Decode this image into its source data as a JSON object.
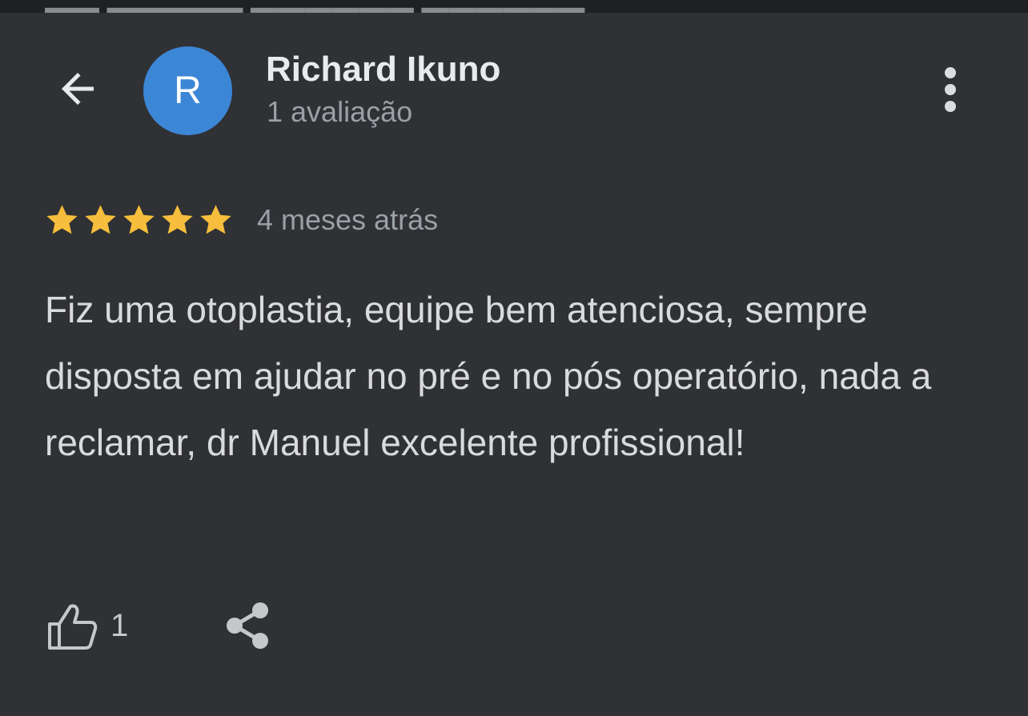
{
  "header": {
    "back_icon": "arrow-left-icon",
    "avatar_initial": "R",
    "avatar_color": "#3c86d6",
    "reviewer_name": "Richard Ikuno",
    "review_count": "1 avaliação",
    "more_icon": "more-vert-icon"
  },
  "review": {
    "rating": 5,
    "max_rating": 5,
    "star_color": "#f6be3c",
    "date": "4 meses atrás",
    "text": "Fiz uma otoplastia, equipe bem atenciosa, sempre disposta em ajudar no pré e no pós operatório, nada a reclamar, dr Manuel excelente profissional!"
  },
  "actions": {
    "like_icon": "thumb-up-icon",
    "like_count": "1",
    "share_icon": "share-icon"
  }
}
